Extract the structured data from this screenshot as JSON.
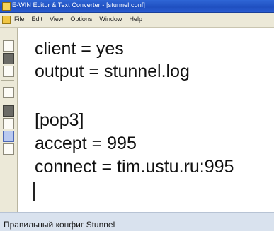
{
  "window": {
    "title": "E-WIN Editor & Text Converter - [stunnel.conf]"
  },
  "menu": {
    "items": [
      "File",
      "Edit",
      "View",
      "Options",
      "Window",
      "Help"
    ]
  },
  "editor": {
    "lines": [
      "client = yes",
      "output = stunnel.log",
      "",
      "[pop3]",
      "accept = 995",
      "connect = tim.ustu.ru:995"
    ]
  },
  "caption": "Правильный конфиг Stunnel",
  "colors": {
    "titlebar": "#1f4fc0",
    "caption_bg": "#d9e2ee",
    "editor_bg": "#ffffff"
  }
}
